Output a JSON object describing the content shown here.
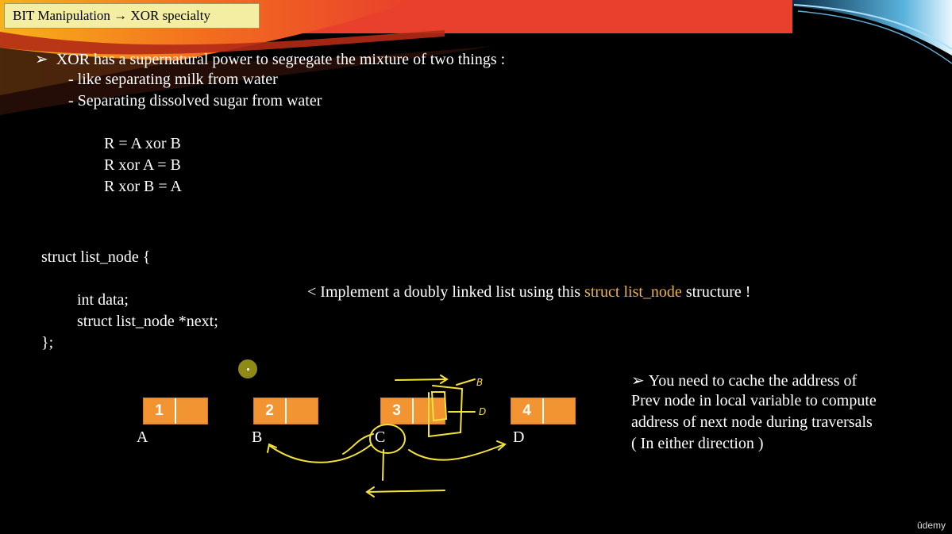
{
  "header": {
    "title": "BIT Manipulation → XOR specialty"
  },
  "intro": {
    "bullet": "XOR has a supernatural power to segregate the mixture of two things :",
    "sub1": "- like separating milk from water",
    "sub2": "- Separating dissolved sugar from water"
  },
  "equations": [
    "R = A xor B",
    "R xor A = B",
    "R xor B = A"
  ],
  "struct": {
    "open": "struct list_node {",
    "line1": "int data;",
    "line2": "struct list_node *next;",
    "close": "};"
  },
  "task": {
    "prefix": "< Implement a doubly linked list using this ",
    "highlight": "struct list_node",
    "suffix": " structure !"
  },
  "nodes": [
    {
      "value": "1",
      "label": "A"
    },
    {
      "value": "2",
      "label": "B"
    },
    {
      "value": "3",
      "label": "C"
    },
    {
      "value": "4",
      "label": "D"
    }
  ],
  "note": {
    "line1": "You need to cache the address of",
    "line2": "Prev node in local variable to compute",
    "line3": "address of next node during traversals",
    "line4": "( In either direction )"
  },
  "annotations": {
    "b_mark": "B",
    "d_mark": "D"
  },
  "watermark": "ûdemy",
  "colors": {
    "accent_red": "#e8402c",
    "title_bg": "#f4eea3",
    "node_orange": "#f39433",
    "highlight": "#e9b44c",
    "ink": "#f2e23a"
  }
}
